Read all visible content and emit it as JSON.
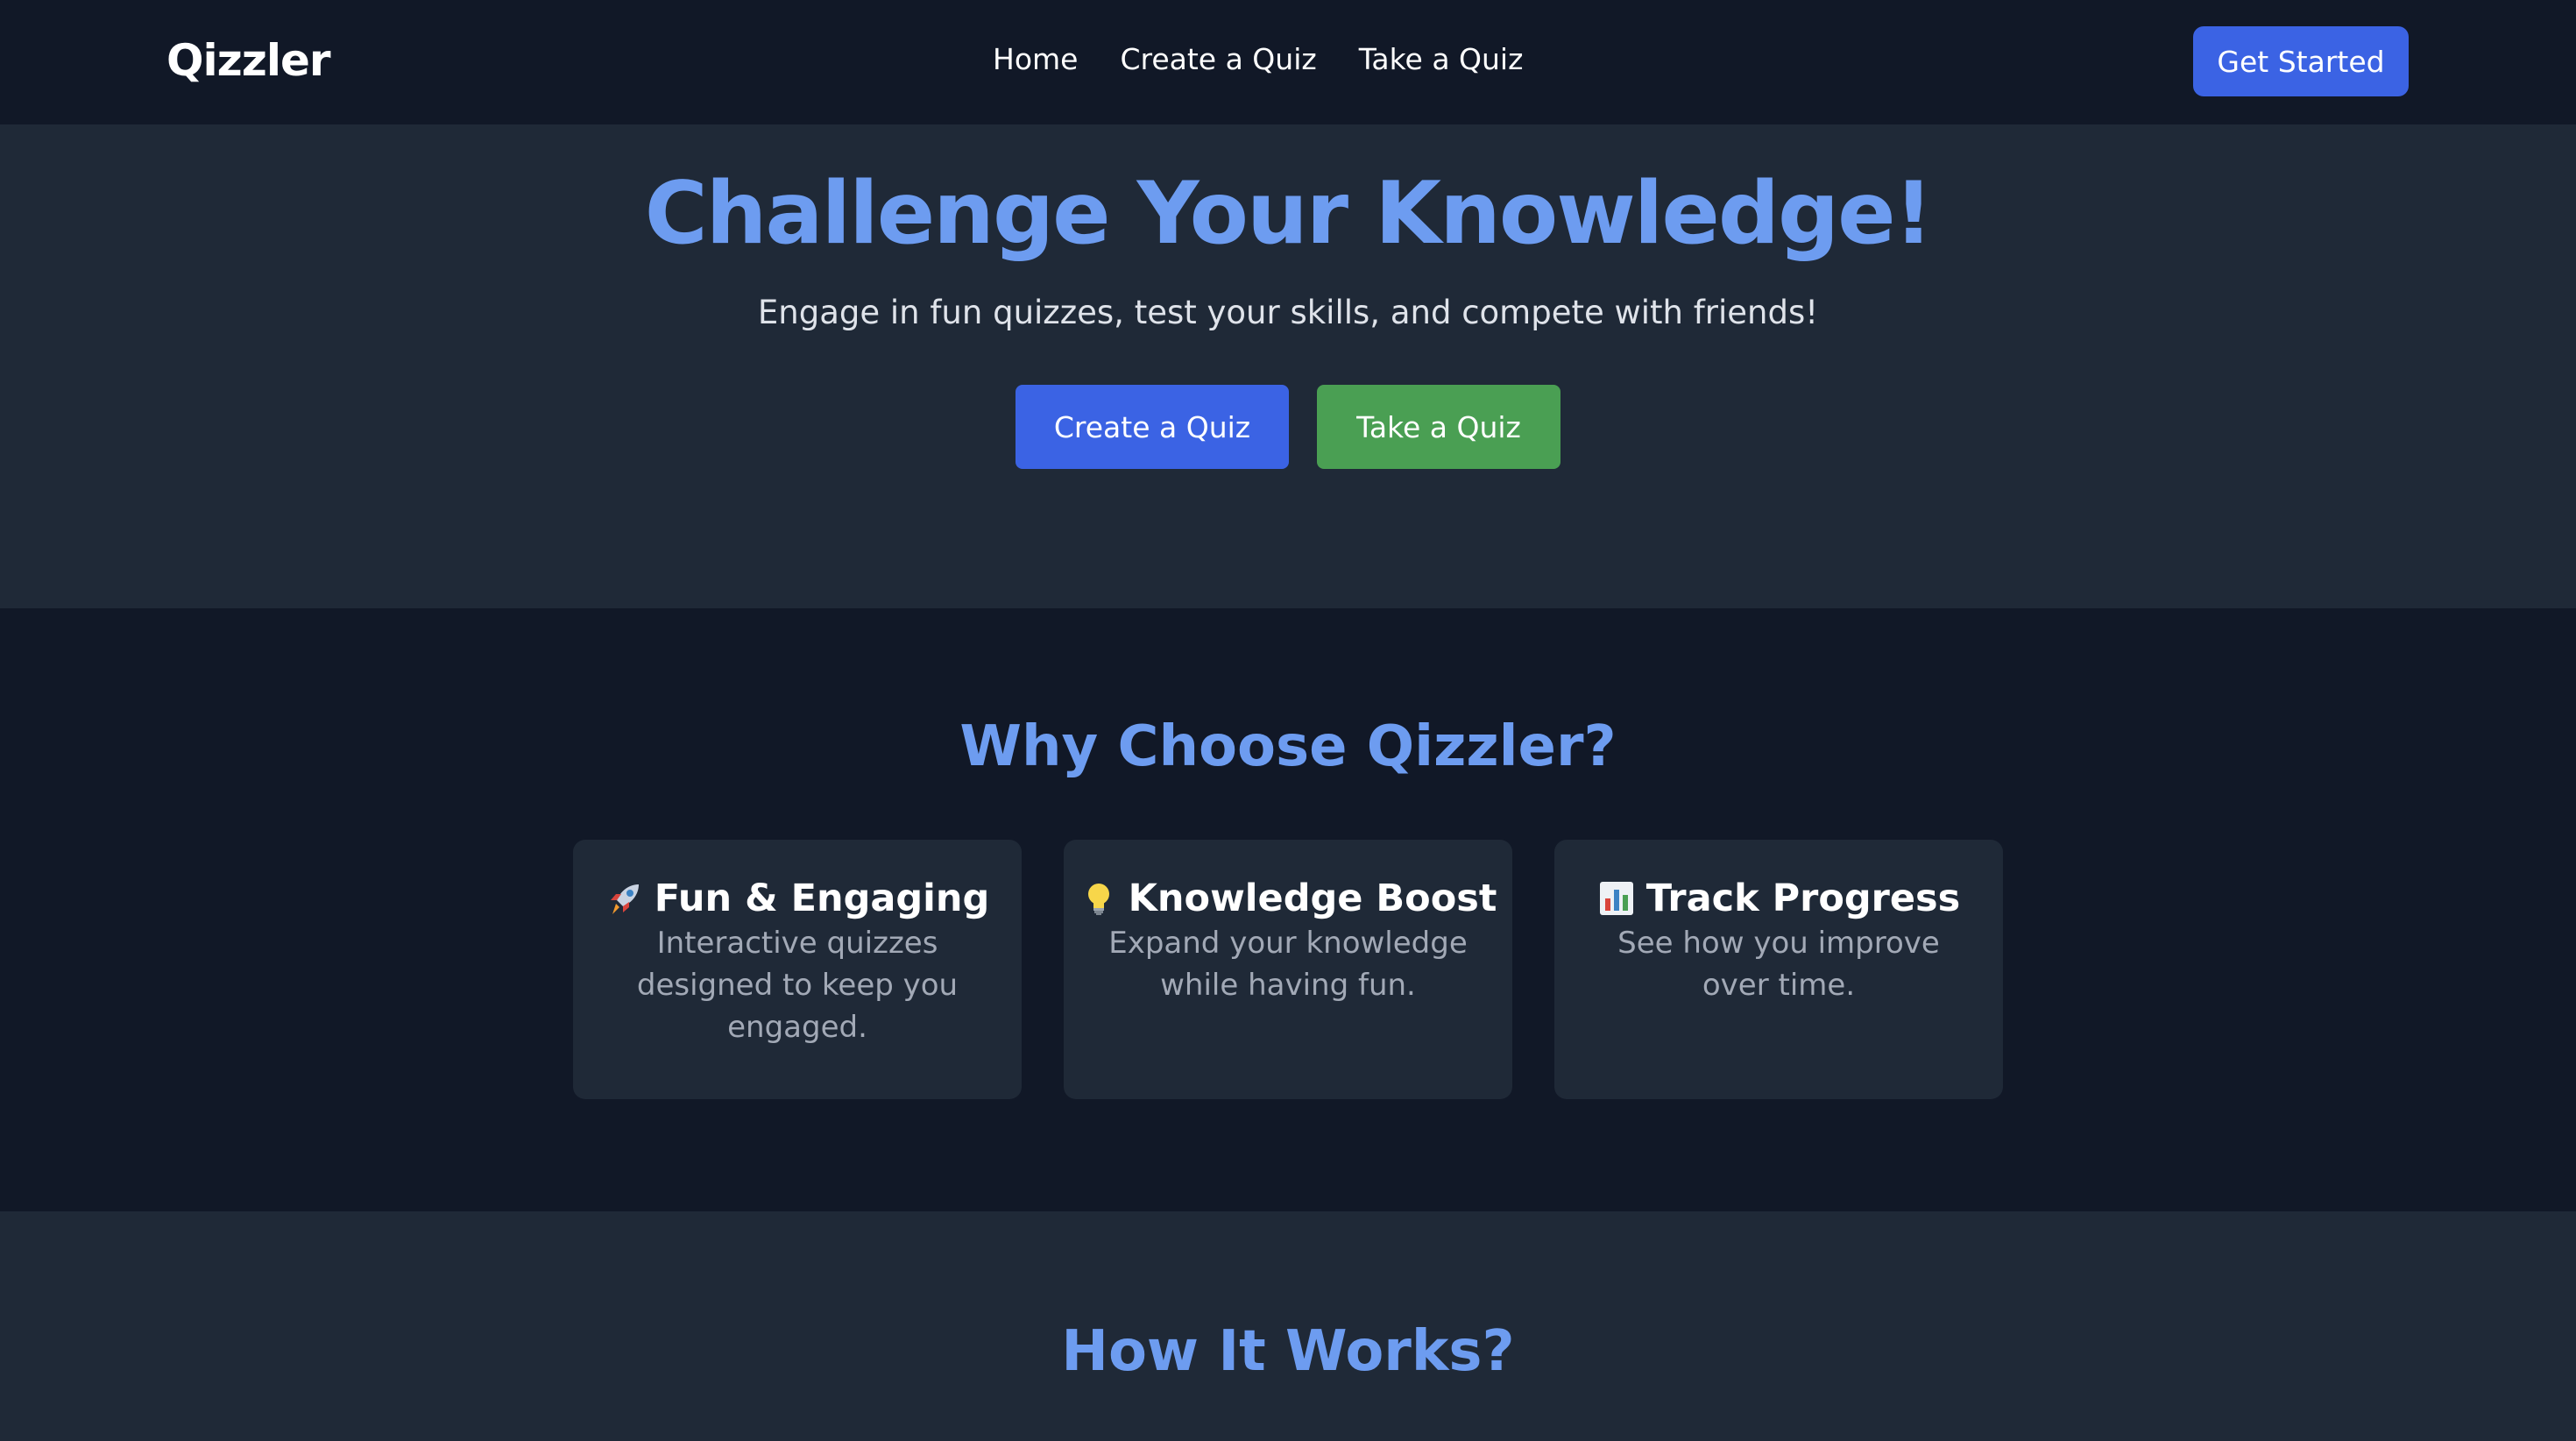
{
  "header": {
    "logo": "Qizzler",
    "nav": [
      "Home",
      "Create a Quiz",
      "Take a Quiz"
    ],
    "cta_label": "Get Started"
  },
  "hero": {
    "title": "Challenge Your Knowledge!",
    "subtitle": "Engage in fun quizzes, test your skills, and compete with friends!",
    "create_label": "Create a Quiz",
    "take_label": "Take a Quiz"
  },
  "why": {
    "title": "Why Choose Qizzler?",
    "cards": [
      {
        "icon": "rocket-icon",
        "title": "Fun & Engaging",
        "desc": "Interactive quizzes designed to keep you engaged."
      },
      {
        "icon": "lightbulb-icon",
        "title": "Knowledge Boost",
        "desc": "Expand your knowledge while having fun."
      },
      {
        "icon": "bar-chart-icon",
        "title": "Track Progress",
        "desc": "See how you improve over time."
      }
    ]
  },
  "how": {
    "title": "How It Works?"
  },
  "colors": {
    "accent": "#6d9cf0",
    "primary_button": "#3b63e4",
    "secondary_button": "#4a9f53",
    "background_dark": "#111827",
    "background_panel": "#1f2937"
  }
}
